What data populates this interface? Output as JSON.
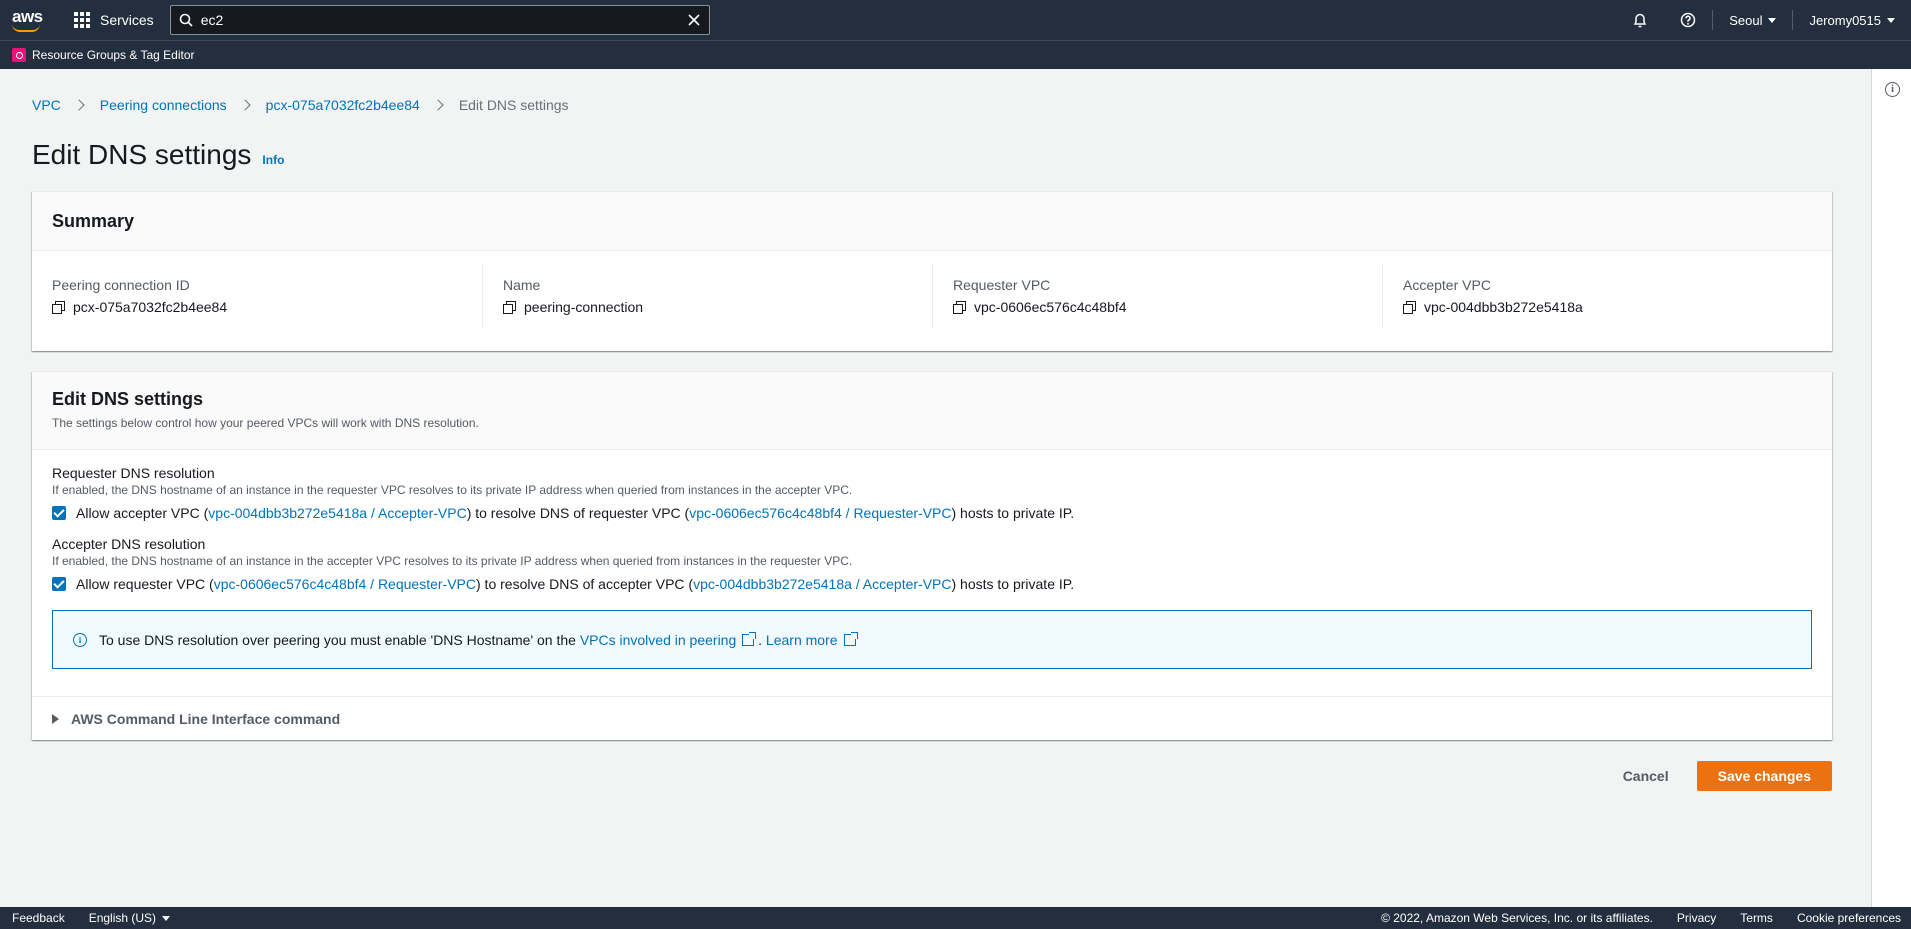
{
  "topnav": {
    "logo_text": "aws",
    "services_label": "Services",
    "search_value": "ec2",
    "region": "Seoul",
    "user": "Jeromy0515"
  },
  "subnav": {
    "resource_groups": "Resource Groups & Tag Editor"
  },
  "breadcrumb": {
    "items": [
      "VPC",
      "Peering connections",
      "pcx-075a7032fc2b4ee84"
    ],
    "current": "Edit DNS settings"
  },
  "page": {
    "title": "Edit DNS settings",
    "info": "Info"
  },
  "summary": {
    "title": "Summary",
    "fields": [
      {
        "label": "Peering connection ID",
        "value": "pcx-075a7032fc2b4ee84"
      },
      {
        "label": "Name",
        "value": "peering-connection"
      },
      {
        "label": "Requester VPC",
        "value": "vpc-0606ec576c4c48bf4"
      },
      {
        "label": "Accepter VPC",
        "value": "vpc-004dbb3b272e5418a"
      }
    ]
  },
  "dns": {
    "title": "Edit DNS settings",
    "description": "The settings below control how your peered VPCs will work with DNS resolution.",
    "requester": {
      "title": "Requester DNS resolution",
      "desc": "If enabled, the DNS hostname of an instance in the requester VPC resolves to its private IP address when queried from instances in the accepter VPC.",
      "checked": true,
      "text1": "Allow accepter VPC (",
      "link1": "vpc-004dbb3b272e5418a / Accepter-VPC",
      "text2": ") to resolve DNS of requester VPC (",
      "link2": "vpc-0606ec576c4c48bf4 / Requester-VPC",
      "text3": ") hosts to private IP."
    },
    "accepter": {
      "title": "Accepter DNS resolution",
      "desc": "If enabled, the DNS hostname of an instance in the accepter VPC resolves to its private IP address when queried from instances in the requester VPC.",
      "checked": true,
      "text1": "Allow requester VPC (",
      "link1": "vpc-0606ec576c4c48bf4 / Requester-VPC",
      "text2": ") to resolve DNS of accepter VPC (",
      "link2": "vpc-004dbb3b272e5418a / Accepter-VPC",
      "text3": ") hosts to private IP."
    },
    "alert": {
      "text": "To use DNS resolution over peering you must enable 'DNS Hostname' on the",
      "link1": "VPCs involved in peering",
      "sep": ".",
      "link2": "Learn more"
    },
    "cli_label": "AWS Command Line Interface command"
  },
  "actions": {
    "cancel": "Cancel",
    "save": "Save changes"
  },
  "footer": {
    "feedback": "Feedback",
    "language": "English (US)",
    "copyright": "© 2022, Amazon Web Services, Inc. or its affiliates.",
    "privacy": "Privacy",
    "terms": "Terms",
    "cookies": "Cookie preferences"
  },
  "colors": {
    "nav_bg": "#232f3e",
    "link": "#0073bb",
    "primary_button": "#ec7211",
    "resource_groups_icon": "#e7157b"
  }
}
